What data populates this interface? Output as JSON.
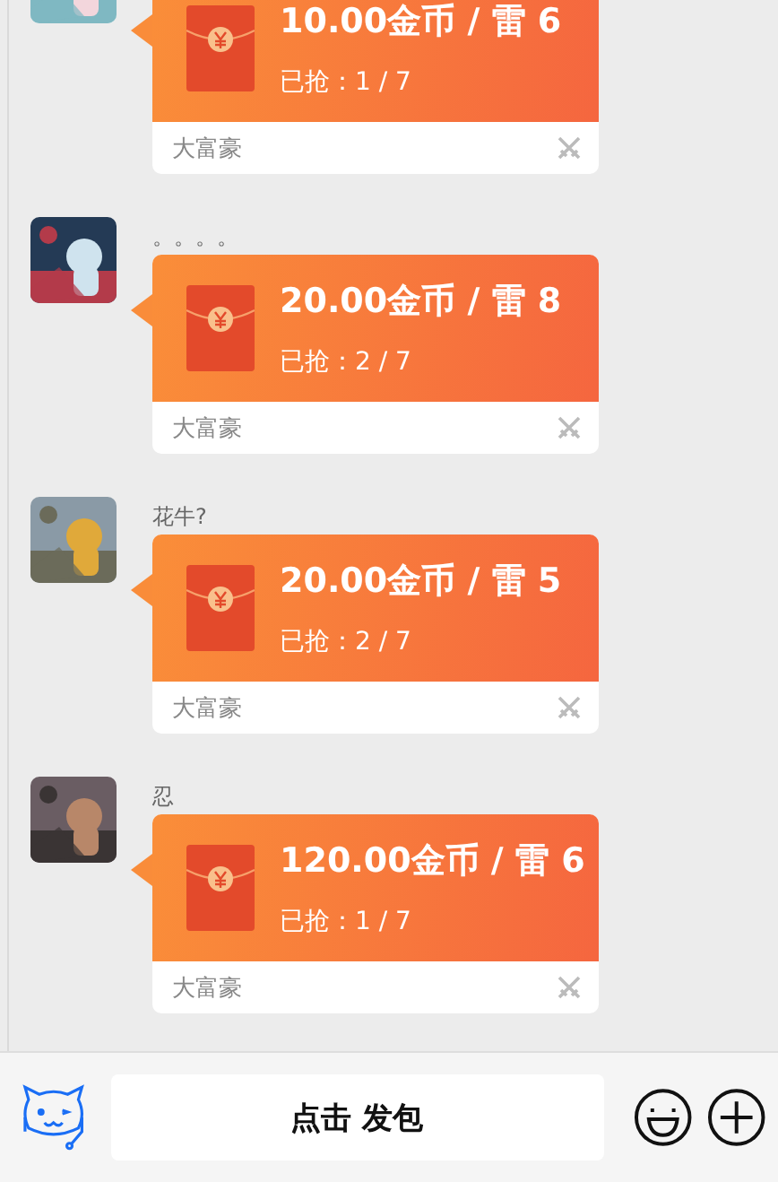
{
  "messages": [
    {
      "title": "10.00金币 / 雷 6",
      "grabbed": "已抢：1 / 7",
      "footer": "大富豪"
    },
    {
      "name": "。。。。",
      "title": "20.00金币 / 雷 8",
      "grabbed": "已抢：2 / 7",
      "footer": "大富豪"
    },
    {
      "name": "花牛?",
      "title": "20.00金币 / 雷 5",
      "grabbed": "已抢：2 / 7",
      "footer": "大富豪"
    },
    {
      "name": "忍",
      "title": "120.00金币 / 雷 6",
      "grabbed": "已抢：1 / 7",
      "footer": "大富豪"
    }
  ],
  "bottom_bar": {
    "send_button": "点击 发包"
  }
}
